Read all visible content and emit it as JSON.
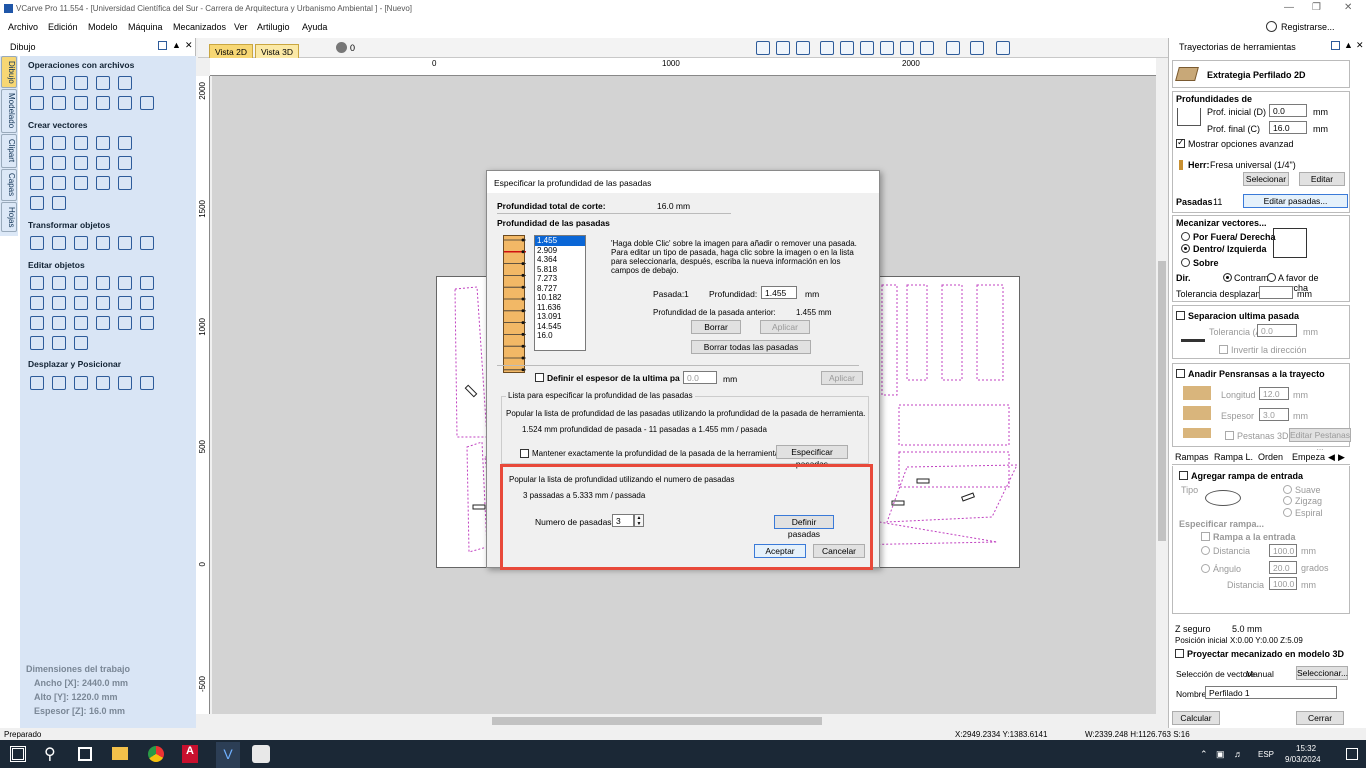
{
  "window": {
    "title": "VCarve Pro 11.554 - [Universidad Científica del Sur - Carrera de Arquitectura y Urbanismo Ambiental ] - [Nuevo]",
    "register": "Registrarse..."
  },
  "menu": [
    "Archivo",
    "Edición",
    "Modelo",
    "Máquina",
    "Mecanizados",
    "Ver",
    "Artilugio",
    "Ayuda"
  ],
  "left": {
    "header": "Dibujo",
    "side_tabs": [
      "Dibujo",
      "Modelado",
      "Clipart",
      "Capas",
      "Hojas"
    ],
    "sections": [
      "Operaciones con archivos",
      "Crear vectores",
      "Transformar objetos",
      "Editar objetos",
      "Desplazar y Posicionar"
    ],
    "dims": {
      "title": "Dimensiones del trabajo",
      "ancho": "Ancho  [X]: 2440.0 mm",
      "alto": "Alto   [Y]: 1220.0 mm",
      "espesor": "Espesor [Z]: 16.0 mm"
    }
  },
  "view": {
    "tab2d": "Vista 2D",
    "tab3d": "Vista 3D",
    "layer": "0",
    "ruler_top": [
      "0",
      "1000",
      "2000"
    ],
    "ruler_left": [
      "2000",
      "1500",
      "1000",
      "500",
      "0",
      "-500"
    ]
  },
  "right": {
    "header": "Trayectorias de herramientas",
    "strategy": "Extrategia Perfilado 2D",
    "depth_title": "Profundidades de",
    "prof_inicial_label": "Prof. inicial (D)",
    "prof_inicial": "0.0",
    "prof_final_label": "Prof. final (C)",
    "prof_final": "16.0",
    "mm": "mm",
    "show_adv": "Mostrar opciones avanzad",
    "tool_label": "Herr:",
    "tool": "Fresa universal (1/4\")",
    "select_btn": "Selecionar",
    "edit_btn": "Editar",
    "passes_label": "Pasadas",
    "passes": "11",
    "edit_passes_btn": "Editar pasadas...",
    "machine_title": "Mecanizar vectores...",
    "outside": "Por Fuera/ Derecha",
    "inside": "Dentro/ Izquierda",
    "on": "Sobre",
    "dir_label": "Dir.",
    "climb": "Contram",
    "conv": "A favor de marcha",
    "allowance_label": "Tolerancia desplazamiento",
    "allowance_unit": "mm",
    "last_pass": "Separacion ultima pasada",
    "tol_label": "Tolerancia (A)",
    "tol_value": "0.0",
    "tol_unit": "mm",
    "invert_dir": "Invertir la dirección",
    "tabs_title": "Anadir Pensransas a la trayecto",
    "length_label": "Longitud",
    "length_value": "12.0",
    "thick_label": "Espesor",
    "thick_value": "3.0",
    "tabs3d": "Pestanas 3D",
    "edit_tabs": "Editar Pestanas ...",
    "subtabs": [
      "Rampas",
      "Rampa L.",
      "Orden",
      "Empeza"
    ],
    "add_ramp": "Agregar rampa de entrada",
    "type_label": "Tipo",
    "smooth": "Suave",
    "zigzag": "Zigzag",
    "spiral": "Espiral",
    "specify_ramp": "Especificar rampa...",
    "ramp_entry": "Rampa a la entrada",
    "distance": "Distancia",
    "distance_value": "100.0",
    "angle": "Ángulo",
    "angle_value": "20.0",
    "angle_unit": "grados",
    "distance2": "Distancia",
    "distance2_value": "100.0",
    "zsafe_label": "Z seguro",
    "zsafe": "5.0 mm",
    "home_label": "Posición inicial",
    "home": "X:0.00 Y:0.00 Z:5.09",
    "project3d": "Proyectar mecanizado en modelo 3D",
    "vec_sel_label": "Selección de vectore",
    "vec_sel_value": "Manual",
    "vec_sel_btn": "Seleccionar...",
    "name_label": "Nombre:",
    "name_value": "Perfilado 1",
    "calc_btn": "Calcular",
    "close_btn": "Cerrar"
  },
  "dialog": {
    "title": "Especificar la profundidad de las pasadas",
    "total_label": "Profundidad total de corte:",
    "total_value": "16.0 mm",
    "passes_title": "Profundidad de las pasadas",
    "list": [
      "1.455",
      "2.909",
      "4.364",
      "5.818",
      "7.273",
      "8.727",
      "10.182",
      "11.636",
      "13.091",
      "14.545",
      "16.0"
    ],
    "help1": "'Haga doble Clic' sobre la imagen para añadir o remover una pasada.",
    "help2": "Para editar un tipo de pasada, haga clic sobre la imagen o en la lista",
    "help3": "para seleccionarla, después, escriba la nueva información en los",
    "help4": "campos de debajo.",
    "pass_label": "Pasada:",
    "pass_value": "1",
    "depth_label": "Profundidad:",
    "depth_value": "1.455",
    "depth_unit": "mm",
    "prev_label": "Profundidad de la pasada anterior:",
    "prev_value": "1.455 mm",
    "delete_btn": "Borrar",
    "apply_btn": "Aplicar",
    "delete_all_btn": "Borrar todas las pasadas",
    "last_thick": "Definir el espesor de la ultima pa",
    "last_thick_value": "0.0",
    "last_unit": "mm",
    "last_apply": "Aplicar",
    "group1": "Lista para especificar la profundidad de las pasadas",
    "g1_text": "Popular la lista de profundidad de las pasadas utilizando la profundidad de la pasada de herramienta.",
    "g1_info": "1.524 mm profundidad de pasada - 11 pasadas a 1.455 mm / pasada",
    "g1_keep": "Mantener exactamente la profundidad de la pasada de la herramienta",
    "g1_btn": "Especificar pasadas",
    "g2_text": "Popular la lista de profundidad utilizando el numero de pasadas",
    "g2_info": "3 passadas a 5.333 mm / passada",
    "num_label": "Numero de pasadas:",
    "num_value": "3",
    "define_btn": "Definir pasadas",
    "ok_btn": "Aceptar",
    "cancel_btn": "Cancelar"
  },
  "status": {
    "left": "Preparado",
    "coords": "X:2949.2334 Y:1383.6141",
    "size": "W:2339.248  H:1126.763  S:16"
  },
  "taskbar": {
    "lang": "ESP",
    "time": "15:32",
    "date": "9/03/2024"
  },
  "colors": {
    "accent": "#e8493a",
    "panel": "#d9e5f5",
    "tab_active": "#f7d774",
    "passes_fill": "#f2b866"
  }
}
